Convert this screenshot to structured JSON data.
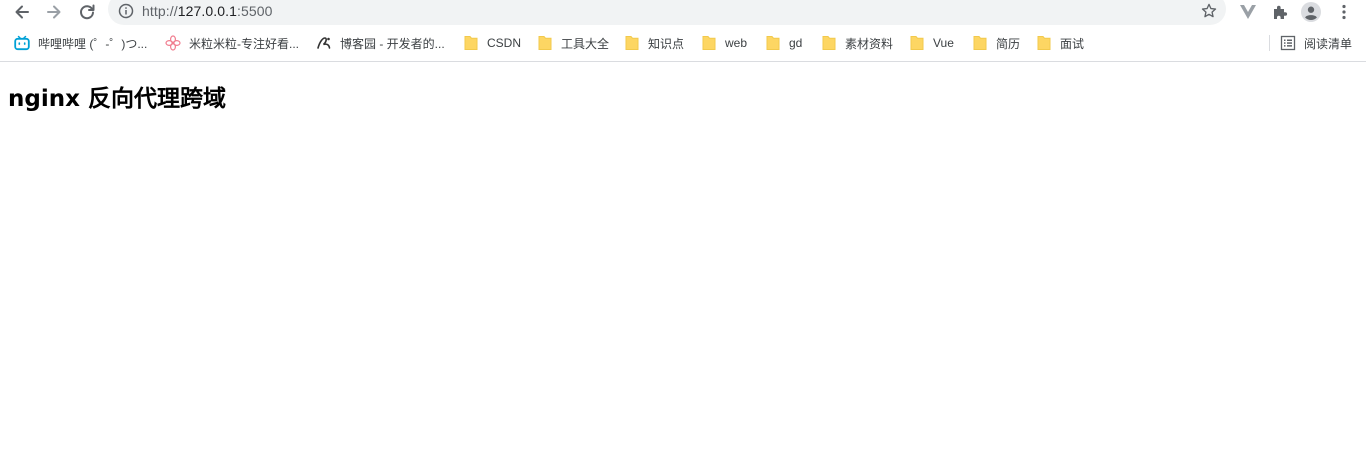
{
  "browser": {
    "address_bar": {
      "url_scheme": "http://",
      "url_host": "127.0.0.1",
      "url_port": ":5500"
    },
    "nav": {
      "back_icon": "arrow-left-icon",
      "forward_icon": "arrow-right-icon",
      "reload_icon": "reload-icon",
      "info_icon": "info-circle-icon",
      "bookmark_star_icon": "star-outline-icon"
    },
    "extensions": [
      "vue-devtools-icon",
      "puzzle-extensions-icon",
      "profile-avatar-icon",
      "kebab-menu-icon"
    ]
  },
  "bookmarks_bar": {
    "items": [
      {
        "label": "哔哩哔哩 (゜-゜)つ...",
        "icon": "bilibili-tv-icon"
      },
      {
        "label": "米粒米粒-专注好看...",
        "icon": "flower-icon"
      },
      {
        "label": "博客园 - 开发者的...",
        "icon": "cnblogs-icon"
      },
      {
        "label": "CSDN",
        "icon": "folder-icon"
      },
      {
        "label": "工具大全",
        "icon": "folder-icon"
      },
      {
        "label": "知识点",
        "icon": "folder-icon"
      },
      {
        "label": "web",
        "icon": "folder-icon"
      },
      {
        "label": "gd",
        "icon": "folder-icon"
      },
      {
        "label": "素材资料",
        "icon": "folder-icon"
      },
      {
        "label": "Vue",
        "icon": "folder-icon"
      },
      {
        "label": "简历",
        "icon": "folder-icon"
      },
      {
        "label": "面试",
        "icon": "folder-icon"
      }
    ],
    "reading_list": {
      "label": "阅读清单",
      "icon": "reading-list-icon"
    }
  },
  "page": {
    "heading": "nginx 反向代理跨域"
  },
  "colors": {
    "folder": "#fdd663",
    "folder_edge": "#f2c94c",
    "bilibili": "#00a1d6",
    "flower": "#f07c8e",
    "omnibox_bg": "#f1f3f4",
    "icon_gray": "#5f6368"
  }
}
